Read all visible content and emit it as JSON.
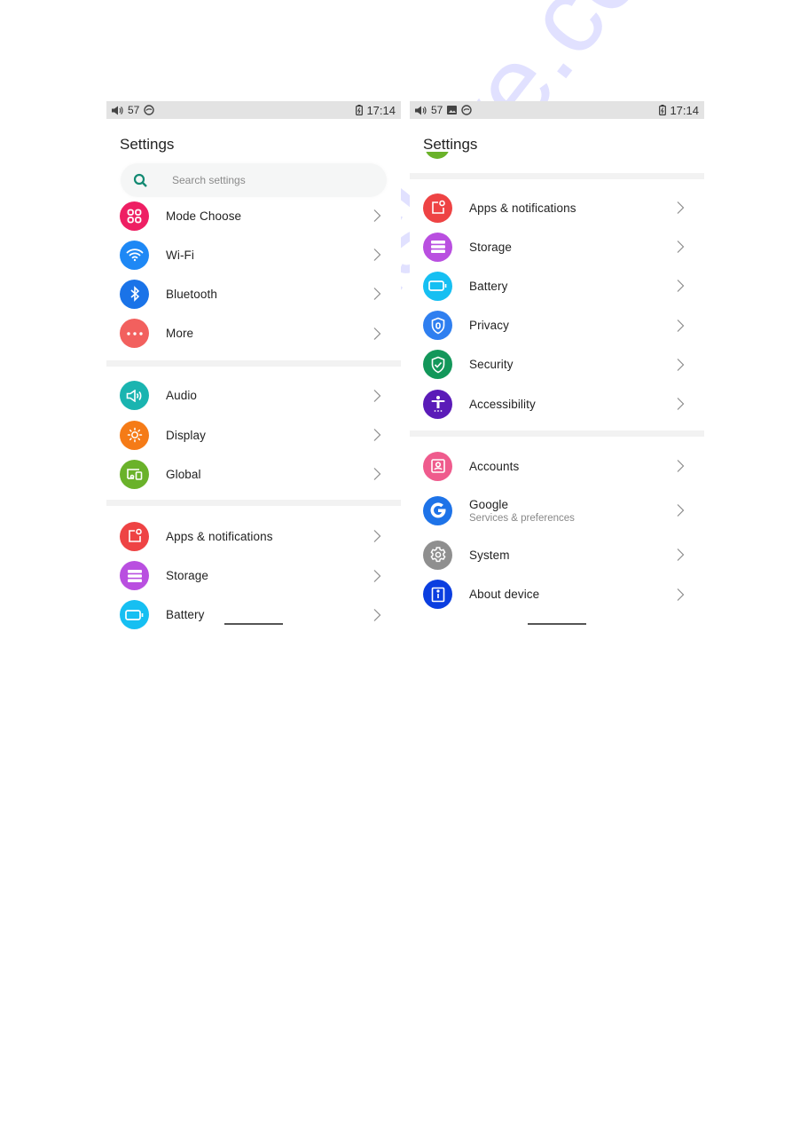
{
  "left_screen": {
    "statusbar": {
      "volume": "57",
      "time": "17:14"
    },
    "title": "Settings",
    "search": {
      "placeholder": "Search settings"
    },
    "sections": [
      [
        {
          "label": "Mode Choose",
          "icon": "grid-icon",
          "color": "#ee1f63"
        },
        {
          "label": "Wi-Fi",
          "icon": "wifi-icon",
          "color": "#1e88f5"
        },
        {
          "label": "Bluetooth",
          "icon": "bluetooth-icon",
          "color": "#1a73e8"
        },
        {
          "label": "More",
          "icon": "more-dots-icon",
          "color": "#f2605e"
        }
      ],
      [
        {
          "label": "Audio",
          "icon": "speaker-icon",
          "color": "#1ab4b0"
        },
        {
          "label": "Display",
          "icon": "brightness-icon",
          "color": "#f57b17"
        },
        {
          "label": "Global",
          "icon": "devices-icon",
          "color": "#6ab22a"
        }
      ],
      [
        {
          "label": "Apps & notifications",
          "icon": "apps-notification-icon",
          "color": "#ee4344"
        },
        {
          "label": "Storage",
          "icon": "storage-icon",
          "color": "#b94fe0"
        },
        {
          "label": "Battery",
          "icon": "battery-icon",
          "color": "#16bff2"
        }
      ]
    ]
  },
  "right_screen": {
    "statusbar": {
      "volume": "57",
      "time": "17:14"
    },
    "title": "Settings",
    "sections": [
      [
        {
          "label": "Apps & notifications",
          "icon": "apps-notification-icon",
          "color": "#ee4344"
        },
        {
          "label": "Storage",
          "icon": "storage-icon",
          "color": "#b94fe0"
        },
        {
          "label": "Battery",
          "icon": "battery-icon",
          "color": "#16bff2"
        },
        {
          "label": "Privacy",
          "icon": "privacy-shield-icon",
          "color": "#2f7ff0"
        },
        {
          "label": "Security",
          "icon": "security-shield-icon",
          "color": "#13975a"
        },
        {
          "label": "Accessibility",
          "icon": "accessibility-icon",
          "color": "#5b1bb8"
        }
      ],
      [
        {
          "label": "Accounts",
          "icon": "account-icon",
          "color": "#ef5b8d"
        },
        {
          "label": "Google",
          "sublabel": "Services & preferences",
          "icon": "google-icon",
          "color": "#1e73e8"
        },
        {
          "label": "System",
          "icon": "gear-icon",
          "color": "#8f8f8f"
        },
        {
          "label": "About device",
          "icon": "info-icon",
          "color": "#0b3ee0"
        }
      ]
    ]
  },
  "watermark": "manualshive.com"
}
